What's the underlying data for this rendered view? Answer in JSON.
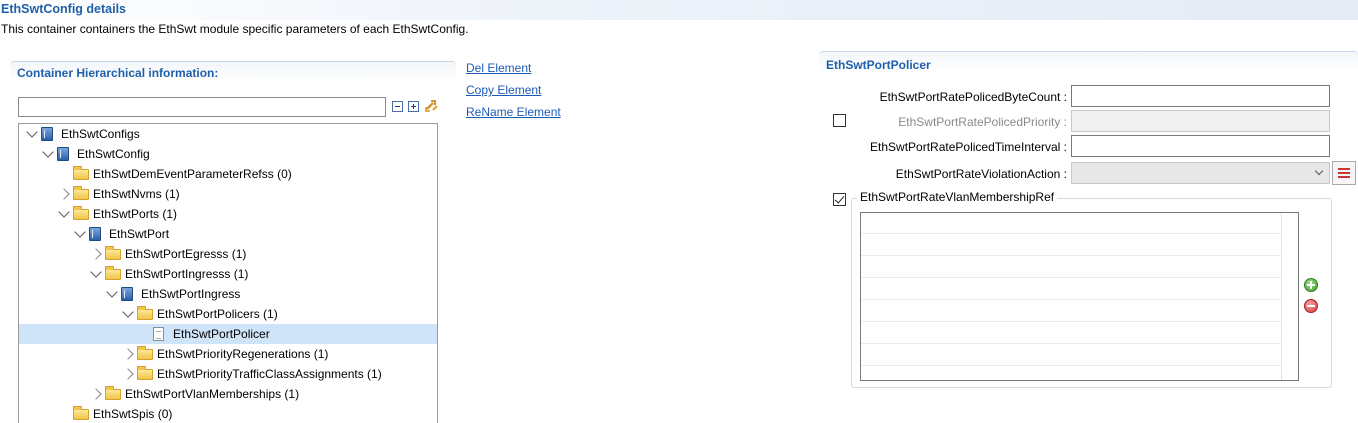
{
  "page": {
    "title": "EthSwtConfig details",
    "description": "This container containers the EthSwt module specific parameters of each EthSwtConfig."
  },
  "hierarchy": {
    "section_title": "Container Hierarchical information:",
    "filter_value": "",
    "tree": [
      {
        "label": "EthSwtConfigs",
        "icon": "module-icon",
        "expander": "open"
      },
      {
        "label": "EthSwtConfig",
        "icon": "module-icon",
        "expander": "open"
      },
      {
        "label": "EthSwtDemEventParameterRefss (0)",
        "icon": "folder-icon",
        "expander": "none"
      },
      {
        "label": "EthSwtNvms (1)",
        "icon": "folder-icon",
        "expander": "closed"
      },
      {
        "label": "EthSwtPorts (1)",
        "icon": "folder-icon",
        "expander": "open"
      },
      {
        "label": "EthSwtPort",
        "icon": "module-icon",
        "expander": "open"
      },
      {
        "label": "EthSwtPortEgresss (1)",
        "icon": "folder-icon",
        "expander": "closed"
      },
      {
        "label": "EthSwtPortIngresss (1)",
        "icon": "folder-icon",
        "expander": "open"
      },
      {
        "label": "EthSwtPortIngress",
        "icon": "module-icon",
        "expander": "open"
      },
      {
        "label": "EthSwtPortPolicers (1)",
        "icon": "folder-icon",
        "expander": "open"
      },
      {
        "label": "EthSwtPortPolicer",
        "icon": "document-icon",
        "expander": "none",
        "selected": true
      },
      {
        "label": "EthSwtPriorityRegenerations (1)",
        "icon": "folder-icon",
        "expander": "closed"
      },
      {
        "label": "EthSwtPriorityTrafficClassAssignments (1)",
        "icon": "folder-icon",
        "expander": "closed"
      },
      {
        "label": "EthSwtPortVlanMemberships (1)",
        "icon": "folder-icon",
        "expander": "closed"
      },
      {
        "label": "EthSwtSpis (0)",
        "icon": "folder-icon",
        "expander": "none"
      }
    ]
  },
  "actions": {
    "del": "Del Element",
    "copy": "Copy Element",
    "rename": "ReName Element"
  },
  "policer": {
    "section_title": "EthSwtPortPolicer",
    "byte_count_label": "EthSwtPortRatePolicedByteCount :",
    "byte_count_value": "",
    "priority_label": "EthSwtPortRatePolicedPriority :",
    "priority_checked": false,
    "priority_value": "",
    "interval_label": "EthSwtPortRatePolicedTimeInterval :",
    "interval_value": "",
    "violation_label": "EthSwtPortRateViolationAction :",
    "violation_value": "",
    "vlan_label": "EthSwtPortRateVlanMembershipRef",
    "vlan_checked": true
  },
  "colors": {
    "title_blue": "#1f5fa9",
    "link_blue": "#1e5bb8",
    "selection": "#cfe4f8"
  }
}
